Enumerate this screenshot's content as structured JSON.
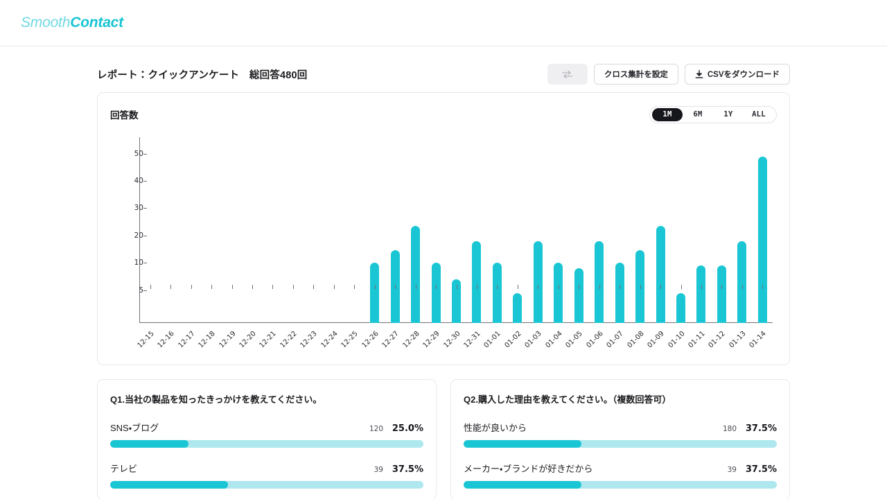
{
  "brand": {
    "light_text": "Smooth",
    "bold_text": "Contact"
  },
  "header": {
    "title": "レポート：クイックアンケート　総回答480回",
    "swap_button_label": "",
    "cross_tab_label": "クロス集計を設定",
    "csv_label": "CSVをダウンロード"
  },
  "chart_card": {
    "title": "回答数",
    "ranges": [
      {
        "label": "1M",
        "active": true
      },
      {
        "label": "6M",
        "active": false
      },
      {
        "label": "1Y",
        "active": false
      },
      {
        "label": "ALL",
        "active": false
      }
    ]
  },
  "chart_data": {
    "type": "bar",
    "title": "回答数",
    "xlabel": "",
    "ylabel": "",
    "ylim": [
      0,
      52
    ],
    "yticks": [
      5,
      10,
      20,
      30,
      40,
      50
    ],
    "grid": false,
    "legend": "none",
    "bar_color": "#1ac6d4",
    "categories": [
      "12-15",
      "12-16",
      "12-17",
      "12-18",
      "12-19",
      "12-20",
      "12-21",
      "12-22",
      "12-23",
      "12-24",
      "12-25",
      "12-26",
      "12-27",
      "12-28",
      "12-29",
      "12-30",
      "12-31",
      "01-01",
      "01-02",
      "01-03",
      "01-04",
      "01-05",
      "01-06",
      "01-07",
      "01-08",
      "01-09",
      "01-10",
      "01-11",
      "01-12",
      "01-13",
      "01-14"
    ],
    "values": [
      0,
      0,
      0,
      0,
      0,
      0,
      0,
      0,
      0,
      0,
      0,
      10,
      14.5,
      23.5,
      10,
      7,
      18,
      10,
      4.5,
      18,
      10,
      9,
      18,
      10,
      14.5,
      23.5,
      4.5,
      9.5,
      9.5,
      18,
      49
    ]
  },
  "questions": [
    {
      "title": "Q1.当社の製品を知ったきっかけを教えてください。",
      "options": [
        {
          "label": "SNS・ブログ",
          "count": "120",
          "percent": "25.0%",
          "fill": 25.0
        },
        {
          "label": "テレビ",
          "count": "39",
          "percent": "37.5%",
          "fill": 37.5
        }
      ]
    },
    {
      "title": "Q2.購入した理由を教えてください。（複数回答可）",
      "options": [
        {
          "label": "性能が良いから",
          "count": "180",
          "percent": "37.5%",
          "fill": 37.5
        },
        {
          "label": "メーカー・ブランドが好きだから",
          "count": "39",
          "percent": "37.5%",
          "fill": 37.5
        }
      ]
    }
  ],
  "colors": {
    "accent": "#1ac6d4",
    "accent_light": "#aee8ee",
    "dark": "#16161d"
  }
}
